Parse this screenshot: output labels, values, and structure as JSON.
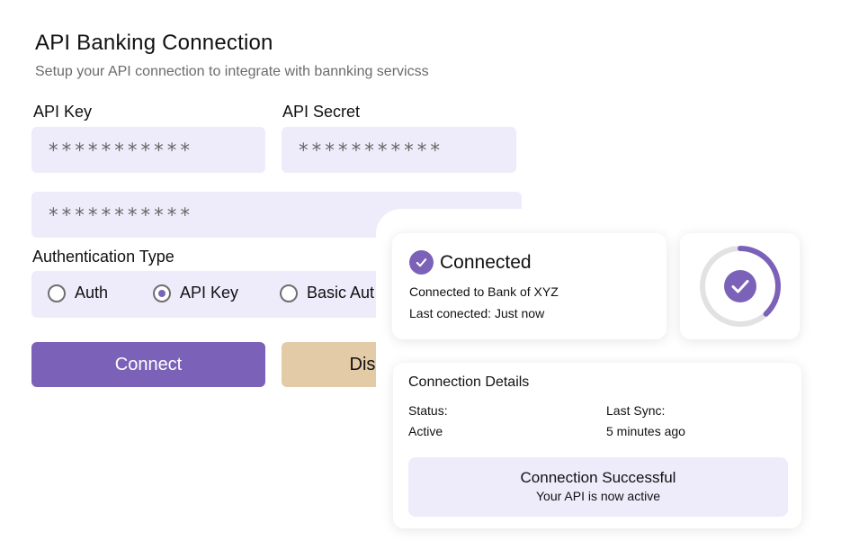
{
  "header": {
    "title": "API Banking Connection",
    "subtitle": "Setup your API connection to integrate with bannking servicss"
  },
  "form": {
    "api_key_label": "API Key",
    "api_key_value": "***********",
    "api_secret_label": "API Secret",
    "api_secret_value": "***********",
    "extra_field_value": "***********",
    "auth_type_label": "Authentication Type",
    "auth_options": [
      {
        "label": "Auth",
        "selected": false
      },
      {
        "label": "API Key",
        "selected": true
      },
      {
        "label": "Basic Aut",
        "selected": false
      }
    ],
    "connect_label": "Connect",
    "disconnect_label": "Dis"
  },
  "status_card": {
    "title": "Connected",
    "bank_line": "Connected to Bank of XYZ",
    "last_connected": "Last conected: Just now",
    "progress_fraction": 0.38
  },
  "details_card": {
    "title": "Connection Details",
    "status_label": "Status:",
    "status_value": "Active",
    "last_sync_label": "Last Sync:",
    "last_sync_value": "5 minutes ago",
    "success_title": "Connection Successful",
    "success_subtitle": "Your API is now active"
  },
  "colors": {
    "accent": "#7b62b8",
    "field_bg": "#eeecfb",
    "disconnect_bg": "#e2cba6",
    "ring_track": "#e2e2e2"
  }
}
